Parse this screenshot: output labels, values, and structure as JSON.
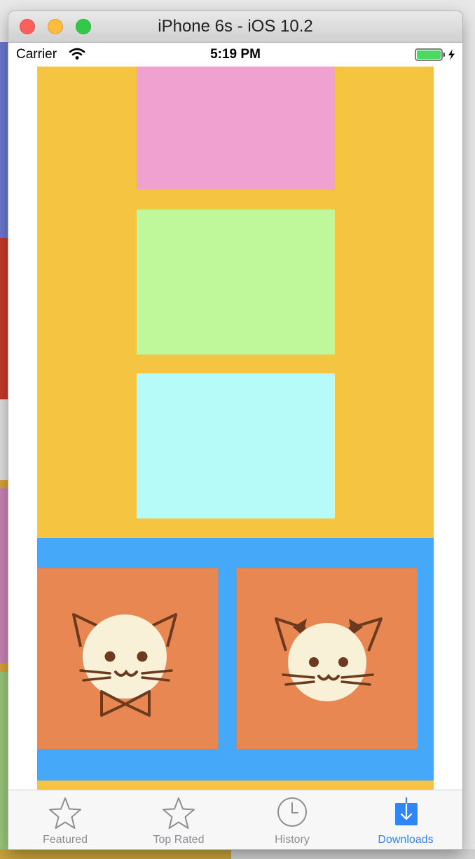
{
  "window": {
    "title": "iPhone 6s - iOS 10.2"
  },
  "status_bar": {
    "carrier": "Carrier",
    "time": "5:19 PM",
    "icons": [
      "wifi-icon",
      "battery-charging-icon"
    ]
  },
  "content": {
    "stacked_boxes": [
      {
        "color": "#f0a1cf"
      },
      {
        "color": "#bff79b"
      },
      {
        "color": "#b7fbf8"
      }
    ],
    "background_top": "#f5c542",
    "background_bottom": "#46a8f8",
    "cards": [
      {
        "icon": "cat-with-bowtie-icon",
        "color": "#e88751"
      },
      {
        "icon": "cat-with-bow-icon",
        "color": "#e88751"
      }
    ]
  },
  "tab_bar": {
    "active_color": "#2f86f6",
    "inactive_color": "#8e8e93",
    "tabs": [
      {
        "label": "Featured",
        "icon": "star-icon",
        "active": false
      },
      {
        "label": "Top Rated",
        "icon": "star-icon",
        "active": false
      },
      {
        "label": "History",
        "icon": "clock-icon",
        "active": false
      },
      {
        "label": "Downloads",
        "icon": "download-icon",
        "active": true
      }
    ]
  }
}
